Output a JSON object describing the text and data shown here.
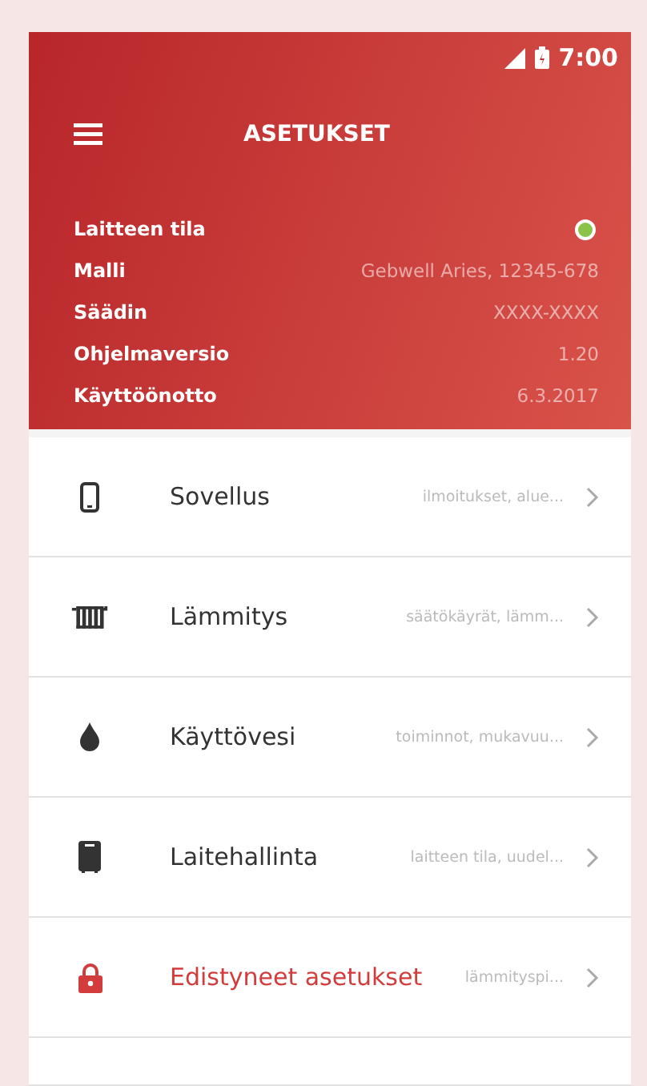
{
  "status_bar": {
    "time": "7:00"
  },
  "header": {
    "title": "ASETUKSET"
  },
  "device_info": [
    {
      "label": "Laitteen tila",
      "kind": "status",
      "color": "#8bc34a"
    },
    {
      "label": "Malli",
      "kind": "text",
      "value": "Gebwell Aries, 12345-678"
    },
    {
      "label": "Säädin",
      "kind": "text",
      "value": "XXXX-XXXX"
    },
    {
      "label": "Ohjelmaversio",
      "kind": "text",
      "value": "1.20"
    },
    {
      "label": "Käyttöönotto",
      "kind": "text",
      "value": "6.3.2017"
    }
  ],
  "menu": [
    {
      "label": "Sovellus",
      "hint": "ilmoitukset, alue...",
      "emphasized": false
    },
    {
      "label": "Lämmitys",
      "hint": "säätökäyrät, lämm...",
      "emphasized": false
    },
    {
      "label": "Käyttövesi",
      "hint": "toiminnot, mukavuu...",
      "emphasized": false
    },
    {
      "label": "Laitehallinta",
      "hint": "laitteen tila, uudel...",
      "emphasized": false
    },
    {
      "label": "Edistyneet asetukset",
      "hint": "lämmityspi...",
      "emphasized": true
    }
  ]
}
